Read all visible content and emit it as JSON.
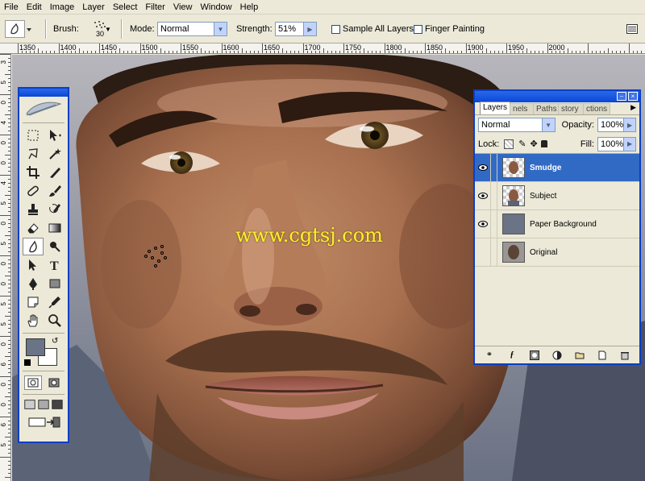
{
  "menu": [
    "File",
    "Edit",
    "Image",
    "Layer",
    "Select",
    "Filter",
    "View",
    "Window",
    "Help"
  ],
  "options": {
    "brush_label": "Brush:",
    "brush_size": "30",
    "mode_label": "Mode:",
    "mode_value": "Normal",
    "strength_label": "Strength:",
    "strength_value": "51%",
    "sample_all_layers": "Sample All Layers",
    "finger_painting": "Finger Painting"
  },
  "ruler": {
    "labels": [
      "1350",
      "1400",
      "1450",
      "1500",
      "1550",
      "1600",
      "1650",
      "1700",
      "1750",
      "1800",
      "1850",
      "1900",
      "1950",
      "2000"
    ]
  },
  "vruler": {
    "labels": [
      "3",
      "5",
      "0",
      "4",
      "0",
      "0",
      "4",
      "5",
      "0",
      "5",
      "0",
      "0",
      "5",
      "5",
      "0",
      "6",
      "0",
      "0",
      "6",
      "5"
    ]
  },
  "watermark": "www.cgtsj.com",
  "layers_panel": {
    "tabs": [
      "Layers",
      "nels",
      "Paths",
      "story",
      "ctions"
    ],
    "blend_mode": "Normal",
    "opacity_label": "Opacity:",
    "opacity_value": "100%",
    "lock_label": "Lock:",
    "fill_label": "Fill:",
    "fill_value": "100%",
    "layers": [
      {
        "name": "Smudge",
        "visible": true,
        "selected": true
      },
      {
        "name": "Subject",
        "visible": true,
        "selected": false
      },
      {
        "name": "Paper Background",
        "visible": true,
        "selected": false
      },
      {
        "name": "Original",
        "visible": false,
        "selected": false
      }
    ]
  },
  "colors": {
    "foreground": "#6b7386",
    "background": "#ffffff",
    "selection": "#316ac5",
    "title_bar": "#0a46d8"
  }
}
